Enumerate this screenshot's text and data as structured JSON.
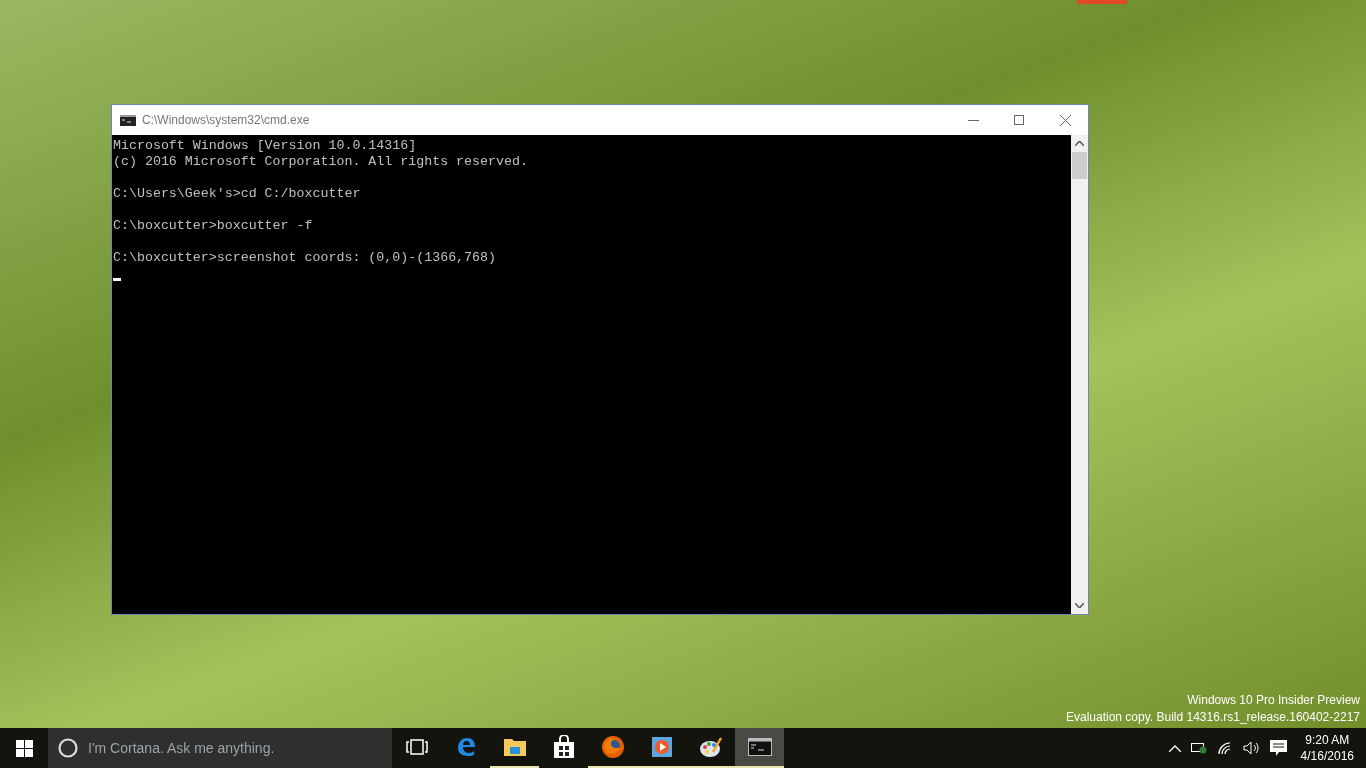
{
  "window": {
    "title": "C:\\Windows\\system32\\cmd.exe"
  },
  "console": {
    "blocks": [
      [
        "Microsoft Windows [Version 10.0.14316]",
        "(c) 2016 Microsoft Corporation. All rights reserved."
      ],
      [
        "C:\\Users\\Geek's>cd C:/boxcutter"
      ],
      [
        "C:\\boxcutter>boxcutter -f"
      ],
      [
        "C:\\boxcutter>screenshot coords: (0,0)-(1366,768)"
      ]
    ],
    "cursor": true
  },
  "desktop": {
    "watermark": [
      "Windows 10 Pro Insider Preview",
      "Evaluation copy. Build 14316.rs1_release.160402-2217"
    ]
  },
  "taskbar": {
    "search": {
      "placeholder": "I'm Cortana. Ask me anything."
    },
    "apps": [
      {
        "kind": "taskview",
        "running": false,
        "selected": false
      },
      {
        "kind": "edge",
        "running": false,
        "selected": false
      },
      {
        "kind": "explorer",
        "running": true,
        "selected": false
      },
      {
        "kind": "store",
        "running": false,
        "selected": false
      },
      {
        "kind": "firefox",
        "running": true,
        "selected": false
      },
      {
        "kind": "media",
        "running": true,
        "selected": false
      },
      {
        "kind": "paint",
        "running": true,
        "selected": false
      },
      {
        "kind": "cmd",
        "running": true,
        "selected": true
      }
    ],
    "time": "9:20 AM",
    "date": "4/16/2016"
  }
}
